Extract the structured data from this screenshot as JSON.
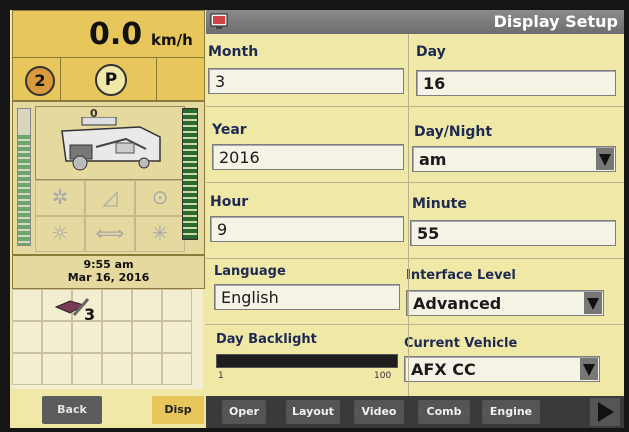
{
  "status": {
    "speed_value": "0.0",
    "speed_unit": "km/h",
    "gear": "2",
    "park": "P",
    "header_count": "0",
    "time": "9:55 am",
    "date": "Mar 16, 2016",
    "grid_count": "3"
  },
  "title": "Display Setup",
  "fields": {
    "month": {
      "label": "Month",
      "value": "3"
    },
    "day": {
      "label": "Day",
      "value": "16"
    },
    "year": {
      "label": "Year",
      "value": "2016"
    },
    "day_night": {
      "label": "Day/Night",
      "value": "am"
    },
    "hour": {
      "label": "Hour",
      "value": "9"
    },
    "minute": {
      "label": "Minute",
      "value": "55"
    },
    "language": {
      "label": "Language",
      "value": "English"
    },
    "interface_level": {
      "label": "Interface Level",
      "value": "Advanced"
    },
    "day_backlight": {
      "label": "Day Backlight",
      "min": "1",
      "max": "100"
    },
    "current_vehicle": {
      "label": "Current Vehicle",
      "value": "AFX CC"
    }
  },
  "nav": {
    "back": "Back",
    "disp": "Disp",
    "tabs": [
      "Oper",
      "Layout",
      "Video",
      "Comb",
      "Engine"
    ]
  },
  "icons": [
    "gear-icon",
    "park-icon",
    "combine-icon",
    "snowflake-icon",
    "ramp-icon",
    "chain-icon",
    "headlight-icon",
    "hazard-icon",
    "beacon-icon",
    "book-icon",
    "wrench-icon",
    "display-setup-icon",
    "next-arrow-icon"
  ]
}
